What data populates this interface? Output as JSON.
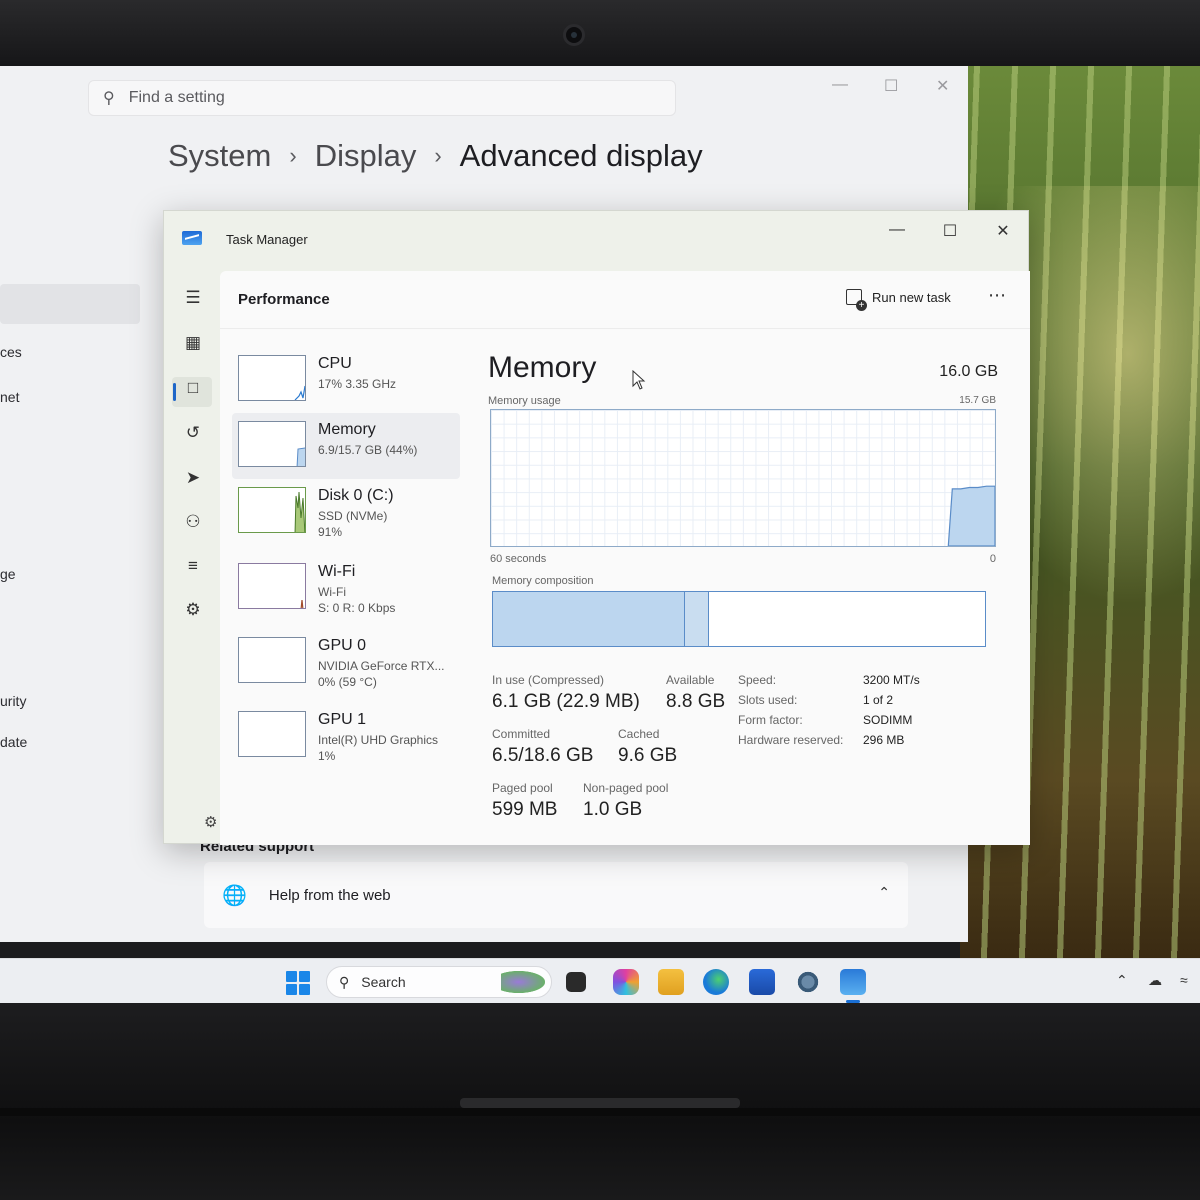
{
  "settings": {
    "search_placeholder": "Find a setting",
    "breadcrumb": [
      "System",
      "Display",
      "Advanced display"
    ],
    "nav_fragments": [
      "ces",
      "net",
      "ge",
      "urity",
      "date"
    ],
    "related_heading": "Related support",
    "help_card_label": "Help from the web"
  },
  "task_manager": {
    "window_title": "Task Manager",
    "page_title": "Performance",
    "run_new_task_label": "Run new task",
    "devices": [
      {
        "name": "CPU",
        "line1": "17% 3.35 GHz",
        "line2": ""
      },
      {
        "name": "Memory",
        "line1": "6.9/15.7 GB (44%)",
        "line2": ""
      },
      {
        "name": "Disk 0 (C:)",
        "line1": "SSD (NVMe)",
        "line2": "91%"
      },
      {
        "name": "Wi-Fi",
        "line1": "Wi-Fi",
        "line2": "S: 0 R: 0 Kbps"
      },
      {
        "name": "GPU 0",
        "line1": "NVIDIA GeForce RTX...",
        "line2": "0% (59 °C)"
      },
      {
        "name": "GPU 1",
        "line1": "Intel(R) UHD Graphics",
        "line2": "1%"
      }
    ],
    "memory": {
      "title": "Memory",
      "total": "16.0 GB",
      "usage_label": "Memory usage",
      "usage_max": "15.7 GB",
      "x_left": "60 seconds",
      "x_right": "0",
      "composition_label": "Memory composition",
      "usage_history_fraction": [
        0,
        0,
        0,
        0,
        0,
        0,
        0,
        0,
        0,
        0,
        0,
        0,
        0,
        0,
        0,
        0,
        0,
        0,
        0,
        0,
        0,
        0,
        0,
        0,
        0,
        0,
        0,
        0,
        0,
        0,
        0,
        0,
        0,
        0,
        0,
        0,
        0,
        0,
        0,
        0,
        0,
        0,
        0,
        0,
        0,
        0,
        0,
        0,
        0,
        0,
        0,
        0,
        0,
        0,
        0.42,
        0.42,
        0.43,
        0.43,
        0.44,
        0.44
      ],
      "composition": {
        "in_use_fraction": 0.39,
        "modified_fraction": 0.05
      },
      "stats": {
        "in_use_label": "In use (Compressed)",
        "in_use_value": "6.1 GB (22.9 MB)",
        "available_label": "Available",
        "available_value": "8.8 GB",
        "committed_label": "Committed",
        "committed_value": "6.5/18.6 GB",
        "cached_label": "Cached",
        "cached_value": "9.6 GB",
        "paged_label": "Paged pool",
        "paged_value": "599 MB",
        "nonpaged_label": "Non-paged pool",
        "nonpaged_value": "1.0 GB"
      },
      "specs": [
        {
          "key": "Speed:",
          "value": "3200 MT/s"
        },
        {
          "key": "Slots used:",
          "value": "1 of 2"
        },
        {
          "key": "Form factor:",
          "value": "SODIMM"
        },
        {
          "key": "Hardware reserved:",
          "value": "296 MB"
        }
      ]
    }
  },
  "taskbar": {
    "search_label": "Search"
  },
  "colors": {
    "accent": "#1e66c8",
    "memory_fill": "#bcd6ef",
    "memory_stroke": "#5a8cc8"
  }
}
